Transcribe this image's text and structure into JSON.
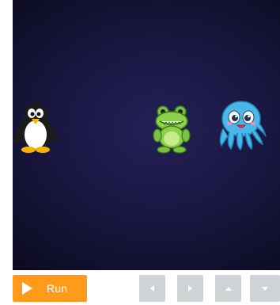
{
  "stage": {
    "background_color": "#1a1744",
    "sprites": [
      {
        "name": "penguin",
        "icon": "penguin-icon"
      },
      {
        "name": "frog",
        "icon": "frog-icon"
      },
      {
        "name": "octopus",
        "icon": "octopus-icon"
      }
    ]
  },
  "controls": {
    "run_label": "Run",
    "run_icon": "play-icon",
    "run_color": "#ff9a1a",
    "direction_buttons": [
      {
        "icon": "arrow-left-icon"
      },
      {
        "icon": "arrow-right-icon"
      },
      {
        "icon": "arrow-up-icon"
      },
      {
        "icon": "arrow-down-icon"
      }
    ],
    "direction_button_color": "#cfd3d6"
  }
}
